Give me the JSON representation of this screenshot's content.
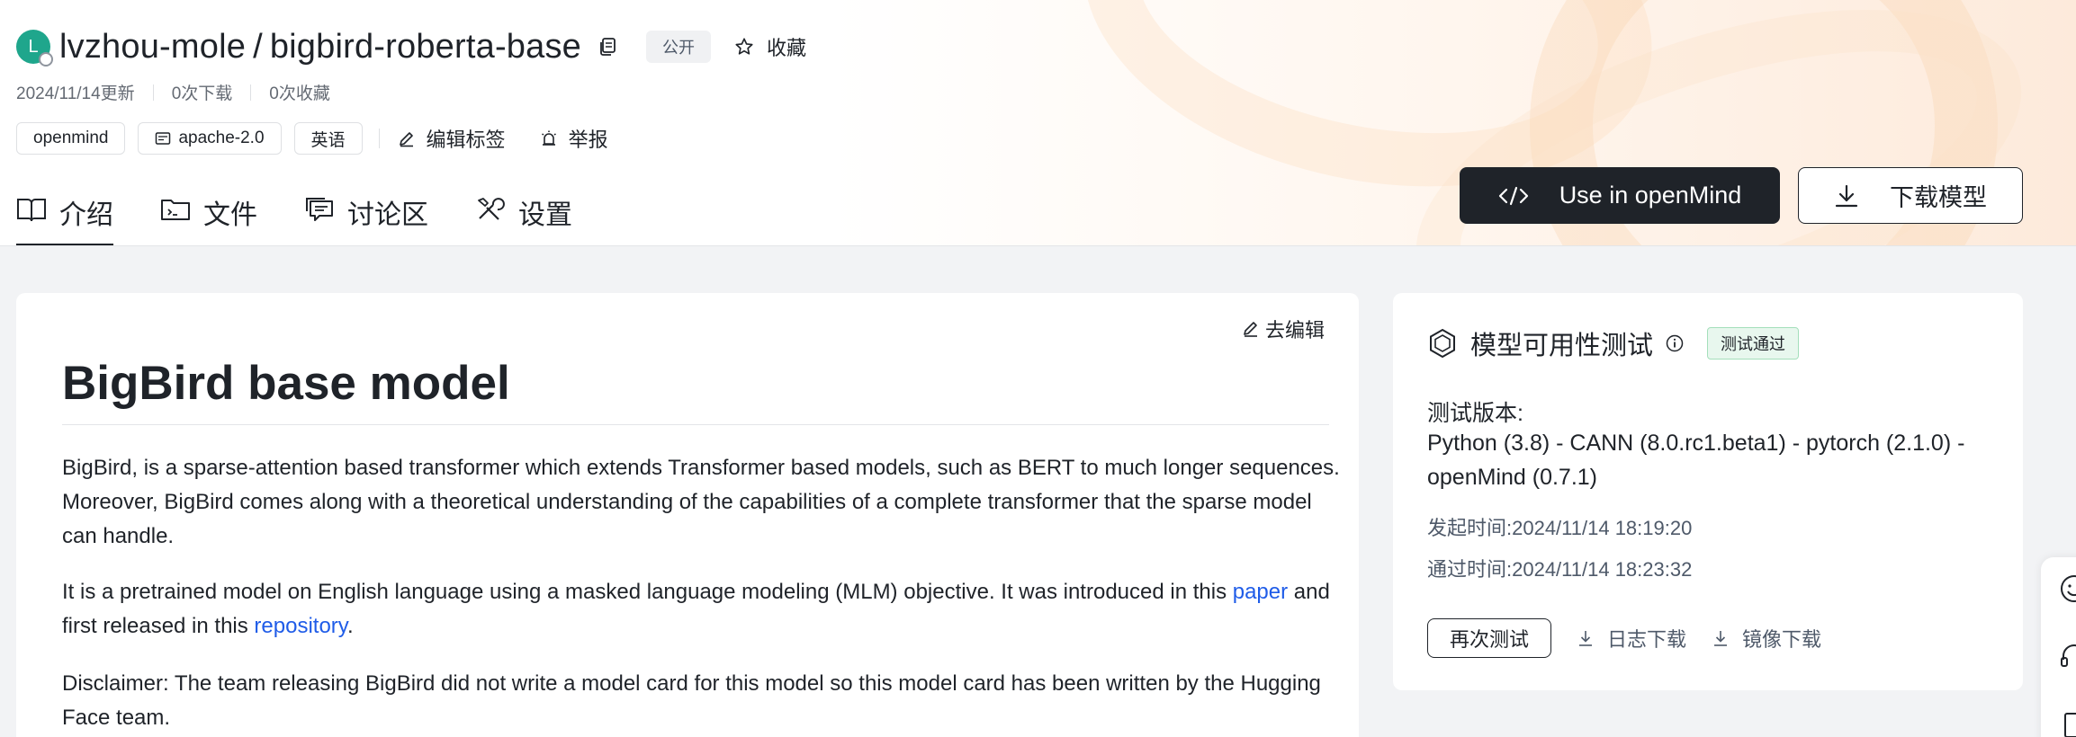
{
  "repo": {
    "avatar_letter": "L",
    "owner": "lvzhou-mole",
    "separator": "/",
    "name": "bigbird-roberta-base",
    "visibility": "公开",
    "favorite_label": "收藏"
  },
  "meta": {
    "updated": "2024/11/14更新",
    "downloads": "0次下载",
    "favorites": "0次收藏"
  },
  "tags": [
    "openmind",
    "apache-2.0",
    "英语"
  ],
  "tag_actions": {
    "edit_tags": "编辑标签",
    "report": "举报"
  },
  "tabs": [
    {
      "label": "介绍",
      "icon": "book-icon",
      "active": true
    },
    {
      "label": "文件",
      "icon": "folder-icon",
      "active": false
    },
    {
      "label": "讨论区",
      "icon": "chat-icon",
      "active": false
    },
    {
      "label": "设置",
      "icon": "tools-icon",
      "active": false
    }
  ],
  "buttons": {
    "use_in_openmind": "Use in openMind",
    "download_model": "下载模型"
  },
  "doc": {
    "edit_label": "去编辑",
    "title": "BigBird base model",
    "para1": "BigBird, is a sparse-attention based transformer which extends Transformer based models, such as BERT to much longer sequences. Moreover, BigBird comes along with a theoretical understanding of the capabilities of a complete transformer that the sparse model can handle.",
    "para2_a": "It is a pretrained model on English language using a masked language modeling (MLM) objective. It was introduced in this ",
    "para2_link1": "paper",
    "para2_b": " and first released in this ",
    "para2_link2": "repository",
    "para2_c": ".",
    "para3": "Disclaimer: The team releasing BigBird did not write a model card for this model so this model card has been written by the Hugging Face team."
  },
  "test": {
    "title": "模型可用性测试",
    "badge": "测试通过",
    "version_label": "测试版本:",
    "version_value": "Python (3.8) - CANN (8.0.rc1.beta1) - pytorch (2.1.0) - openMind (0.7.1)",
    "start_time": "发起时间:2024/11/14 18:19:20",
    "pass_time": "通过时间:2024/11/14 18:23:32",
    "retest": "再次测试",
    "log_download": "日志下载",
    "image_download": "镜像下载"
  },
  "colors": {
    "primary_dark": "#1f2329",
    "link": "#1f5ce8",
    "avatar": "#1fa68c",
    "pass_bg": "#e8f7ee"
  }
}
